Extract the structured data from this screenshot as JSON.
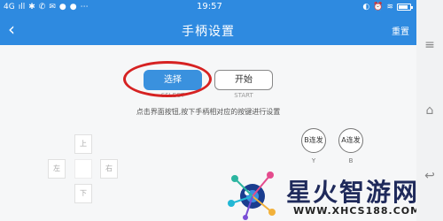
{
  "status_bar": {
    "network": "4G",
    "signal": "ıll",
    "icons_left": [
      "✱",
      "✆",
      "✉",
      "●",
      "●",
      "⋯"
    ],
    "time": "19:57",
    "icons_right": [
      "◐",
      "⏰",
      "≋"
    ]
  },
  "header": {
    "title": "手柄设置",
    "back_glyph": "‹",
    "reset_label": "重置"
  },
  "buttons": {
    "select_label": "选择",
    "select_caption": "SELECT",
    "start_label": "开始",
    "start_caption": "START"
  },
  "instruction": "点击界面按钮,按下手柄相对应的按键进行设置",
  "dpad": {
    "up": "上",
    "left": "左",
    "right": "右",
    "down": "下"
  },
  "turbo": {
    "b_label": "B连发",
    "b_caption": "Y",
    "a_label": "A连发",
    "a_caption": "B"
  },
  "watermark": {
    "text": "星火智游网",
    "url": "WWW.XHCS188.COM"
  },
  "nav": {
    "menu_glyph": "≡",
    "home_glyph": "⌂",
    "back_glyph": "↩"
  },
  "colors": {
    "accent": "#2e8ae0",
    "highlight": "#d62222"
  },
  "battery_level": 0.8
}
